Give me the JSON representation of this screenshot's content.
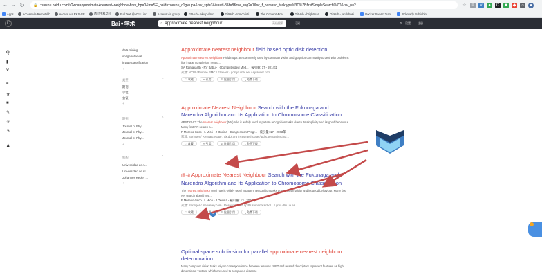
{
  "browser": {
    "url": "xueshu.baidu.com/s?wd=approximate+nearest+neighbour&rsv_bp=0&tn=SE_baiduxueshu_c1gjeupa&rsv_spt=3&ie=utf-8&f=8&rsv_sug2=1&sc_f_para=sc_tasktype%3D%7BfirstSimpleSearch%7D&rsv_n=2",
    "bookmarks": [
      {
        "label": "Apps",
        "icon": "apps-grid-icon"
      },
      {
        "label": "Access via Remotelib",
        "icon": "globe-icon"
      },
      {
        "label": "Access via RKS-GE",
        "icon": "globe-icon"
      },
      {
        "label": "透过中科华科",
        "icon": "globe-icon"
      },
      {
        "label": "Full Text @NTU Libr...",
        "icon": "globe-icon"
      },
      {
        "label": "Access via group",
        "icon": "globe-icon"
      },
      {
        "label": "GitHub - akulpvi/nic...",
        "icon": "github-icon"
      },
      {
        "label": "GitHub - tomchristi...",
        "icon": "github-icon"
      },
      {
        "label": "The ContentMine ...",
        "icon": "github-icon"
      },
      {
        "label": "GitHub - brightmar...",
        "icon": "github-icon"
      },
      {
        "label": "GitHub - jarulchnsi...",
        "icon": "github-icon"
      },
      {
        "label": "Docker Swarm Tuto...",
        "icon": "docker-icon"
      },
      {
        "label": "Scholarly Publishin...",
        "icon": "linkedin-icon"
      }
    ]
  },
  "header": {
    "logo_left": "Bai",
    "logo_right": "学术",
    "search_value": "approximate nearest neighbour",
    "advanced_label": "高级搜索",
    "subscribe_label": "订阅",
    "settings_label": "设置",
    "login_label": "注册"
  },
  "filters": {
    "top_items": [
      "data mining",
      "image retrieval",
      "image classification"
    ],
    "type_head": "类型",
    "type_items": [
      "期刊",
      "学位",
      "会议"
    ],
    "journal_head": "期刊",
    "journal_items": [
      "Journal of Phy...",
      "Journal of Phy...",
      "Journal of Phy..."
    ],
    "org_head": "机构",
    "org_items": [
      "Universidad de A...",
      "Universidad de Al...",
      "Johannes Kepler ..."
    ],
    "more": "+"
  },
  "results": [
    {
      "title_hl": "Approximate nearest neighbour",
      "title_rest": " field based optic disk detection",
      "abstract_hl": "Approximate Nearest Neighbour",
      "abstract_rest": " Field maps are commonly used by computer vision and graphics community to deal with problems like image completion, retarg...",
      "meta": "SA Ramakanth - RV Babu - 《Computerized Med... - 被引量: 17 - 2014年",
      "source": "来源: NCBI / Europe PMC / Elsevier / goldjournal.net / ejcancer.com"
    },
    {
      "title_hl": "Approximate Nearest Neighbour",
      "title_rest": " Search with the Fukunaga and Narendra Algorithm and Its Application to Chromosome Classification.",
      "abstract_pre": "ABSTRACT The ",
      "abstract_hl": "nearest neighbour",
      "abstract_rest": " (NN) rule is widely used in pattern recognition tasks due to its simplicity and its good behaviour. Many fast NN search a...",
      "meta": "F Moreno-Seco - L Micó - J Oncina - Congress on Progr... - 被引量: 17 - 2003年",
      "source": "来源: Springer / ResearchGate / dx.doi.org / ResearchGate / pdfs.semanticschol..."
    },
    {
      "tag": "[图书]",
      "title_hl": "Approximate Nearest Neighbour",
      "title_rest": " Search with the Fukunaga and Narendra Algorithm and Its Application to Chromosome Classification",
      "abstract_pre": "The ",
      "abstract_hl": "nearest neighbour",
      "abstract_rest": " (NN) rule is widely used in pattern recognition tasks due to its simplicity and its good behaviour. Many fast NN search algorithms...",
      "meta": "F Moreno-Seco - L Micó - J Oncina - 被引量: 13 - 2003年",
      "source": "来源: Springer / mendeley.com / ResearchGate / pdfs.semanticschol... / grfia.dlsi.ua.es"
    },
    {
      "title_plain": "Optimal space subdivision for parallel ",
      "title_hl": "approximate nearest neighbour",
      "title_rest": " determination",
      "abstract_rest": "Many computer vision tasks rely on correspondence between features. SIFT and related descriptors represent features as high-dimensional vectors, which are used to compute a distance"
    }
  ],
  "actions": {
    "collect": "收藏",
    "cite": "引用",
    "batch_cite": "批量引用",
    "free_download": "免费下载"
  },
  "colors": {
    "title_blue": "#3a3fa8",
    "highlight_red": "#e0483c",
    "header_dark": "#2b2e35",
    "arrow_red": "#c44a4a",
    "chevron_blue": "#3f7fc4",
    "chevron_dark": "#1f3d66",
    "float_button": "#4a90e2"
  }
}
